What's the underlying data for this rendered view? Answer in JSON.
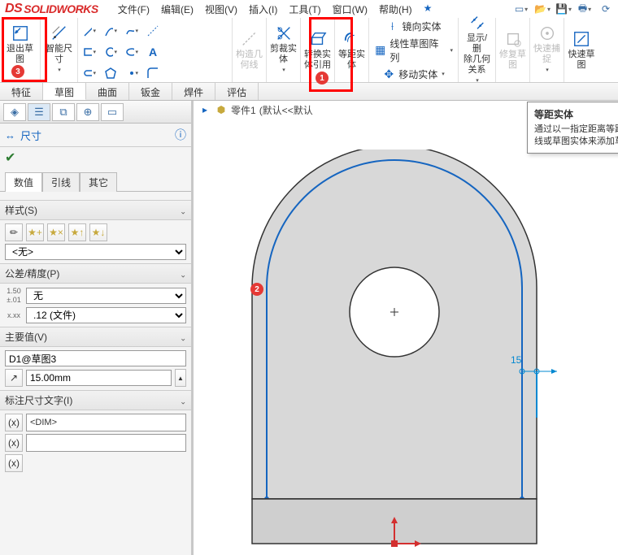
{
  "app": {
    "brand_ds": "DS",
    "brand_name": "SOLIDWORKS"
  },
  "menu": {
    "file": "文件(F)",
    "edit": "编辑(E)",
    "view": "视图(V)",
    "insert": "插入(I)",
    "tools": "工具(T)",
    "window": "窗口(W)",
    "help": "帮助(H)",
    "star": "★"
  },
  "ribbon": {
    "exit_sketch": "退出草图",
    "smart_dim": "智能尺寸",
    "construct_geom_top": "构造几",
    "construct_geom_bot": "何线",
    "trim_top": "剪裁实",
    "trim_bot": "体",
    "convert_top": "转换实",
    "convert_bot": "体引用",
    "offset_top": "等距实",
    "offset_bot": "体",
    "mirror": "镜向实体",
    "linear_pattern": "线性草图阵列",
    "move": "移动实体",
    "show_del_top": "显示/删",
    "show_del_mid": "除几何",
    "show_del_bot": "关系",
    "repair_top": "修复草",
    "repair_bot": "图",
    "quick_snap_top": "快速捕",
    "quick_snap_bot": "捉",
    "quick_sketch_top": "快速草",
    "quick_sketch_bot": "图"
  },
  "cm_tabs": {
    "feature": "特征",
    "sketch": "草图",
    "surface": "曲面",
    "sheetmetal": "钣金",
    "weldment": "焊件",
    "evaluate": "评估"
  },
  "tooltip": {
    "title": "等距实体",
    "body": "通过以一指定距离等距面、边线、曲线或草图实体来添加草图实体。"
  },
  "breadcrumb": {
    "part": "零件1",
    "state": "(默认<<默认"
  },
  "pm": {
    "title": "尺寸",
    "tabs": {
      "value": "数值",
      "leader": "引线",
      "other": "其它"
    },
    "sec_style": "样式(S)",
    "style_none": "<无>",
    "sec_tol": "公差/精度(P)",
    "tol_none": "无",
    "tol_doc": ".12 (文件)",
    "sec_primary": "主要值(V)",
    "primary_name": "D1@草图3",
    "primary_val": "15.00mm",
    "sec_dimtext": "标注尺寸文字(I)",
    "dim_token": "<DIM>"
  },
  "canvas": {
    "dim_value": "15"
  },
  "badges": {
    "b1": "1",
    "b2": "2",
    "b3": "3"
  },
  "text_A": "A"
}
